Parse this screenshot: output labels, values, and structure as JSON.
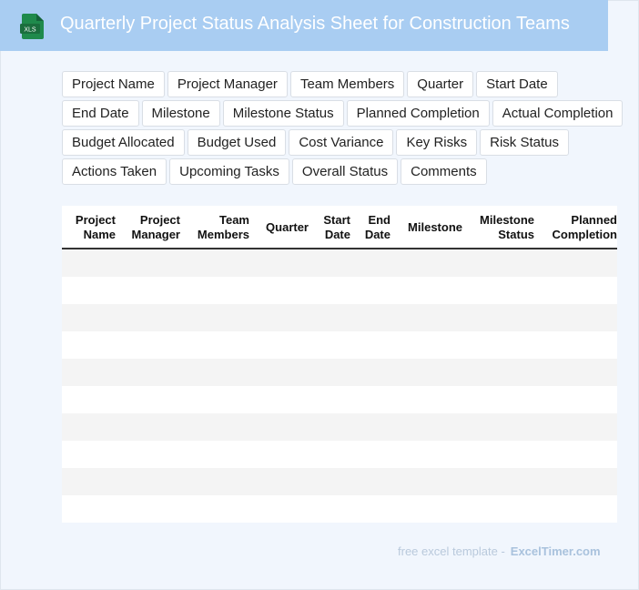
{
  "header": {
    "title": "Quarterly Project Status Analysis Sheet for Construction Teams",
    "icon_label": "XLS"
  },
  "fields": [
    "Project Name",
    "Project Manager",
    "Team Members",
    "Quarter",
    "Start Date",
    "End Date",
    "Milestone",
    "Milestone Status",
    "Planned Completion",
    "Actual Completion",
    "Budget Allocated",
    "Budget Used",
    "Cost Variance",
    "Key Risks",
    "Risk Status",
    "Actions Taken",
    "Upcoming Tasks",
    "Overall Status",
    "Comments"
  ],
  "table": {
    "columns": [
      [
        "Project",
        "Name"
      ],
      [
        "Project",
        "Manager"
      ],
      [
        "Team",
        "Members"
      ],
      [
        "Quarter"
      ],
      [
        "Start",
        "Date"
      ],
      [
        "End",
        "Date"
      ],
      [
        "Milestone"
      ],
      [
        "Milestone",
        "Status"
      ],
      [
        "Planned",
        "Completion"
      ]
    ],
    "empty_rows": 10
  },
  "footer": {
    "prefix": "free excel template -",
    "brand": "ExcelTimer.com"
  },
  "colors": {
    "header_bg": "#a9cdf2",
    "page_bg": "#f1f6fd",
    "icon_green": "#1e7a45"
  }
}
